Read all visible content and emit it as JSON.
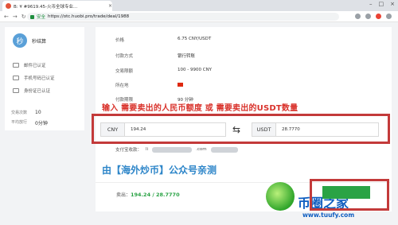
{
  "browser": {
    "tab_title": "B: ¥ #9619.45-火币全球专业...",
    "secure_label": "安全",
    "url": "https://otc.huobi.pro/trade/deal/1988"
  },
  "sidebar": {
    "avatar_char": "秒",
    "username": "秒结算",
    "verifications": [
      {
        "label": "邮件已认证"
      },
      {
        "label": "手机号码已认证"
      },
      {
        "label": "身份证已认证"
      }
    ],
    "stats": [
      {
        "label": "交易次数",
        "value": "10"
      },
      {
        "label": "平均放行",
        "value": "0分钟"
      }
    ]
  },
  "order": {
    "rows": [
      {
        "label": "价格",
        "value": "6.75 CNY/USDT"
      },
      {
        "label": "付款方式",
        "value": "银行转账"
      },
      {
        "label": "交易限额",
        "value": "100 - 9900 CNY"
      },
      {
        "label": "所在地",
        "value": ""
      },
      {
        "label": "付款期限",
        "value": "90 分钟"
      }
    ]
  },
  "annotation_top": "输入 需要卖出的人民币额度 或 需要卖出的USDT数量",
  "annotation_bottom": "由【海外炒币】公众号亲测",
  "inputs": {
    "left_unit": "CNY",
    "left_value": "194.24",
    "right_unit": "USDT",
    "right_value": "28.7770",
    "swap_symbol": "⇆"
  },
  "payment": {
    "label": "支付宝收款：",
    "prefix": "li",
    "middle": ".com"
  },
  "seller": {
    "label": "卖出：",
    "value": "194.24 / 28.7770"
  },
  "watermark": {
    "text": "币圈之家",
    "url": "www.tuufy.com"
  },
  "colors": {
    "annotation_red": "#d9322b",
    "annotation_blue": "#2e86c9",
    "highlight_box": "#c33a3a",
    "buy_green": "#2aa345"
  }
}
